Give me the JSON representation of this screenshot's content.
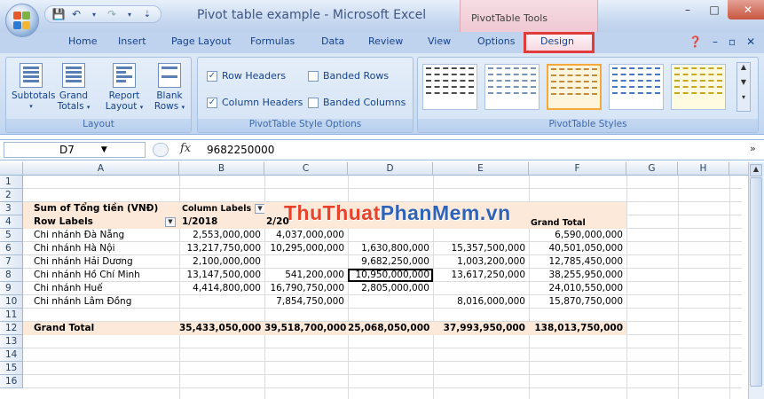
{
  "window": {
    "title": "Pivot table example - Microsoft Excel",
    "context_label": "PivotTable Tools",
    "minimize": "–",
    "restore": "□",
    "close": "✕"
  },
  "ribbon_tabs": [
    "Home",
    "Insert",
    "Page Layout",
    "Formulas",
    "Data",
    "Review",
    "View",
    "Options",
    "Design"
  ],
  "active_tab": "Design",
  "ribbon": {
    "layout_group": {
      "label": "Layout",
      "subtotals": "Subtotals",
      "grand_totals_1": "Grand",
      "grand_totals_2": "Totals",
      "report_layout_1": "Report",
      "report_layout_2": "Layout",
      "blank_rows_1": "Blank",
      "blank_rows_2": "Rows"
    },
    "style_options_group": {
      "label": "PivotTable Style Options",
      "row_headers": "Row Headers",
      "column_headers": "Column Headers",
      "banded_rows": "Banded Rows",
      "banded_columns": "Banded Columns",
      "row_headers_checked": true,
      "column_headers_checked": true,
      "banded_rows_checked": false,
      "banded_columns_checked": false
    },
    "styles_group": {
      "label": "PivotTable Styles"
    }
  },
  "formula_bar": {
    "cell_ref": "D7",
    "fx": "fx",
    "value": "9682250000"
  },
  "columns": [
    "A",
    "B",
    "C",
    "D",
    "E",
    "F",
    "G",
    "H"
  ],
  "rows": [
    "1",
    "2",
    "3",
    "4",
    "5",
    "6",
    "7",
    "8",
    "9",
    "10",
    "11",
    "12",
    "13",
    "14",
    "15",
    "16"
  ],
  "pivot": {
    "sum_label": "Sum of Tổng tiền (VNĐ)",
    "column_labels": "Column Labels",
    "row_labels": "Row Labels",
    "col_1": "1/2018",
    "col_2": "2/20",
    "grand_total_col": "Grand Total",
    "data_rows": [
      {
        "name": "Chi nhánh Đà Nẵng",
        "b": "2,553,000,000",
        "c": "4,037,000,000",
        "d": "",
        "e": "",
        "f": "6,590,000,000"
      },
      {
        "name": "Chi nhánh Hà Nội",
        "b": "13,217,750,000",
        "c": "10,295,000,000",
        "d": "1,630,800,000",
        "e": "15,357,500,000",
        "f": "40,501,050,000"
      },
      {
        "name": "Chi nhánh Hải Dương",
        "b": "2,100,000,000",
        "c": "",
        "d": "9,682,250,000",
        "e": "1,003,200,000",
        "f": "12,785,450,000"
      },
      {
        "name": "Chi nhánh Hồ Chí Minh",
        "b": "13,147,500,000",
        "c": "541,200,000",
        "d": "10,950,000,000",
        "e": "13,617,250,000",
        "f": "38,255,950,000"
      },
      {
        "name": "Chi nhánh Huế",
        "b": "4,414,800,000",
        "c": "16,790,750,000",
        "d": "2,805,000,000",
        "e": "",
        "f": "24,010,550,000"
      },
      {
        "name": "Chi nhánh Lâm Đồng",
        "b": "",
        "c": "7,854,750,000",
        "d": "",
        "e": "8,016,000,000",
        "f": "15,870,750,000"
      }
    ],
    "grand_total_row": {
      "name": "Grand Total",
      "b": "35,433,050,000",
      "c": "39,518,700,000",
      "d": "25,068,050,000",
      "e": "37,993,950,000",
      "f": "138,013,750,000"
    }
  },
  "watermark": {
    "part1": "ThuThuat",
    "part2": "PhanMem",
    "part3": ".vn"
  }
}
